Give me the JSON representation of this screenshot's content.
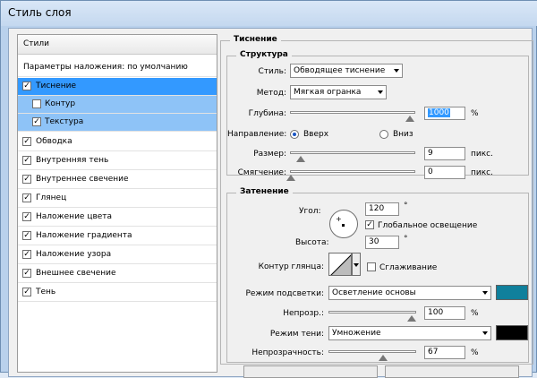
{
  "window": {
    "title": "Стиль слоя"
  },
  "styles_panel": {
    "header": "Стили",
    "blend_options": "Параметры наложения: по умолчанию",
    "items": [
      {
        "label": "Тиснение",
        "checked": true,
        "state": "selected"
      },
      {
        "label": "Контур",
        "checked": false,
        "state": "sub-selected"
      },
      {
        "label": "Текстура",
        "checked": true,
        "state": "sub-selected"
      },
      {
        "label": "Обводка",
        "checked": true
      },
      {
        "label": "Внутренняя тень",
        "checked": true
      },
      {
        "label": "Внутреннее свечение",
        "checked": true
      },
      {
        "label": "Глянец",
        "checked": true
      },
      {
        "label": "Наложение цвета",
        "checked": true
      },
      {
        "label": "Наложение градиента",
        "checked": true
      },
      {
        "label": "Наложение узора",
        "checked": true
      },
      {
        "label": "Внешнее свечение",
        "checked": true
      },
      {
        "label": "Тень",
        "checked": true
      }
    ]
  },
  "section_title": "Тиснение",
  "structure": {
    "title": "Структура",
    "style_label": "Стиль:",
    "style_value": "Обводящее тиснение",
    "method_label": "Метод:",
    "method_value": "Мягкая огранка",
    "depth_label": "Глубина:",
    "depth_value": "1000",
    "depth_unit": "%",
    "depth_level": 1.0,
    "direction_label": "Направление:",
    "dir_up": "Вверх",
    "dir_down": "Вниз",
    "direction_selected": "up",
    "size_label": "Размер:",
    "size_value": "9",
    "size_unit": "пикс.",
    "soften_label": "Смягчение:",
    "soften_value": "0",
    "soften_unit": "пикс."
  },
  "shading": {
    "title": "Затенение",
    "angle_label": "Угол:",
    "angle_value": "120",
    "angle_unit": "°",
    "global_light_label": "Глобальное освещение",
    "global_light_checked": true,
    "altitude_label": "Высота:",
    "altitude_value": "30",
    "altitude_unit": "°",
    "gloss_contour_label": "Контур глянца:",
    "antialias_label": "Сглаживание",
    "antialias_checked": false,
    "highlight_mode_label": "Режим подсветки:",
    "highlight_mode_value": "Осветление основы",
    "highlight_color": "#10809c",
    "highlight_opacity_label": "Непрозр.:",
    "highlight_opacity_value": "100",
    "highlight_opacity_unit": "%",
    "shadow_mode_label": "Режим тени:",
    "shadow_mode_value": "Умножение",
    "shadow_color": "#000000",
    "shadow_opacity_label": "Непрозрачность:",
    "shadow_opacity_value": "67",
    "shadow_opacity_unit": "%"
  }
}
